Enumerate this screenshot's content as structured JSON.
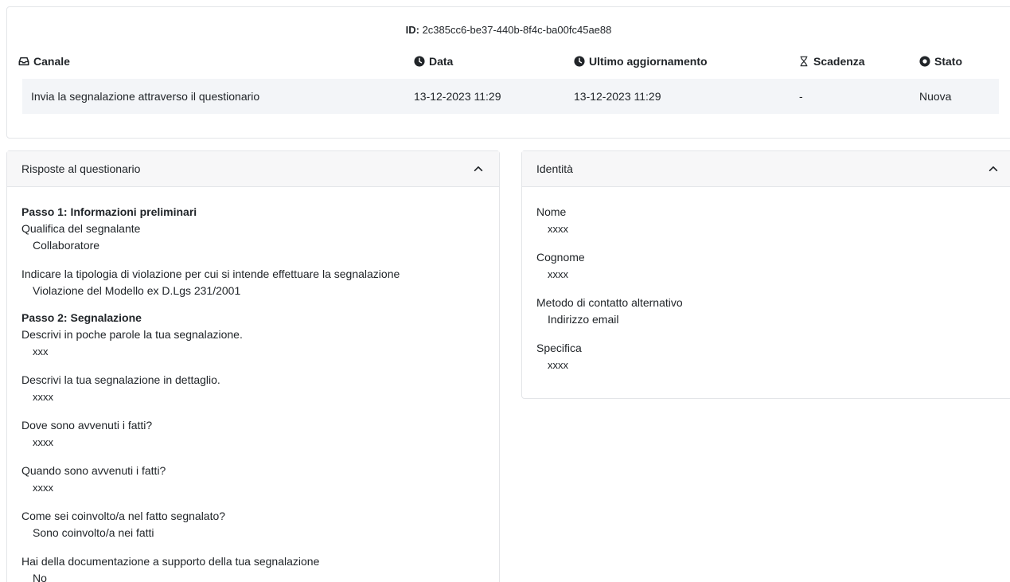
{
  "report": {
    "id_label": "ID:",
    "id_value": "2c385cc6-be37-440b-8f4c-ba00fc45ae88"
  },
  "table": {
    "headers": {
      "canale": "Canale",
      "data": "Data",
      "ultimo": "Ultimo aggiornamento",
      "scadenza": "Scadenza",
      "stato": "Stato"
    },
    "row": {
      "canale": "Invia la segnalazione attraverso il questionario",
      "data": "13-12-2023 11:29",
      "ultimo": "13-12-2023 11:29",
      "scadenza": "-",
      "stato": "Nuova"
    }
  },
  "answers_panel": {
    "title": "Risposte al questionario",
    "step1_title": "Passo 1: Informazioni preliminari",
    "step1": [
      {
        "q": "Qualifica del segnalante",
        "a": "Collaboratore"
      },
      {
        "q": "Indicare la tipologia di violazione per cui si intende effettuare la segnalazione",
        "a": "Violazione del Modello ex D.Lgs 231/2001"
      }
    ],
    "step2_title": "Passo 2: Segnalazione",
    "step2": [
      {
        "q": "Descrivi in poche parole la tua segnalazione.",
        "a": "xxx"
      },
      {
        "q": "Descrivi la tua segnalazione in dettaglio.",
        "a": "xxxx"
      },
      {
        "q": "Dove sono avvenuti i fatti?",
        "a": "xxxx"
      },
      {
        "q": "Quando sono avvenuti i fatti?",
        "a": "xxxx"
      },
      {
        "q": "Come sei coinvolto/a nel fatto segnalato?",
        "a": "Sono coinvolto/a nei fatti"
      },
      {
        "q": "Hai della documentazione a supporto della tua segnalazione",
        "a": "No"
      }
    ]
  },
  "identity_panel": {
    "title": "Identità",
    "fields": [
      {
        "label": "Nome",
        "value": "xxxx"
      },
      {
        "label": "Cognome",
        "value": "xxxx"
      },
      {
        "label": "Metodo di contatto alternativo",
        "value": "Indirizzo email"
      },
      {
        "label": "Specifica",
        "value": "xxxx"
      }
    ]
  },
  "icons": {
    "canale": "inbox-icon",
    "data": "clock-icon",
    "ultimo": "clock-icon",
    "scadenza": "hourglass-icon",
    "stato": "circle-dot-icon",
    "collapse": "chevron-up-icon"
  }
}
